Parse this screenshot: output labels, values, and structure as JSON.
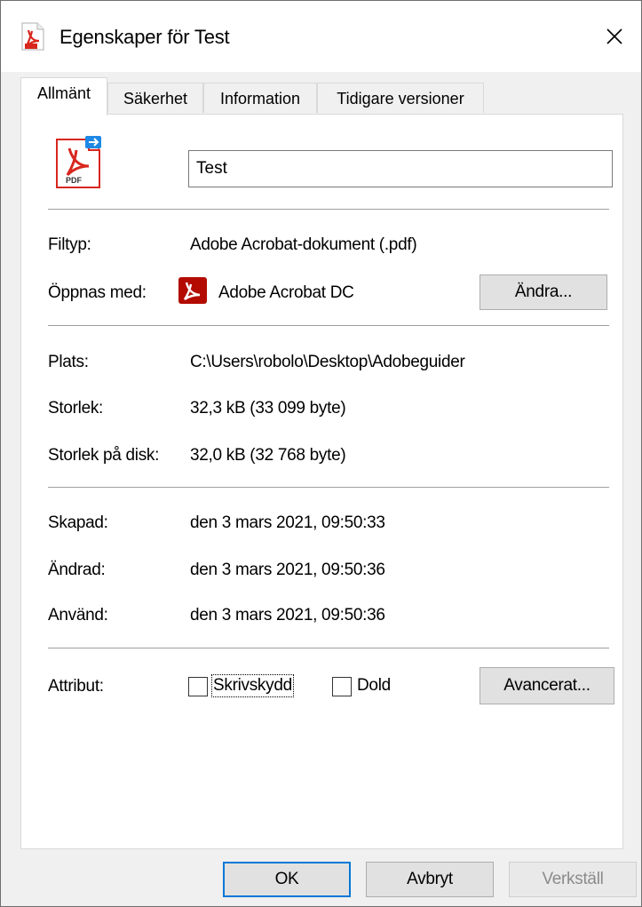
{
  "window": {
    "title": "Egenskaper för Test",
    "close_glyph": "✕"
  },
  "tabs": [
    {
      "label": "Allmänt",
      "active": true
    },
    {
      "label": "Säkerhet",
      "active": false
    },
    {
      "label": "Information",
      "active": false
    },
    {
      "label": "Tidigare versioner",
      "active": false
    }
  ],
  "general": {
    "file_icon_caption": "PDF",
    "name_value": "Test",
    "filetype": {
      "label": "Filtyp:",
      "value": "Adobe Acrobat-dokument (.pdf)"
    },
    "opens_with": {
      "label": "Öppnas med:",
      "value": "Adobe Acrobat DC",
      "change_button": "Ändra..."
    },
    "location": {
      "label": "Plats:",
      "value": "C:\\Users\\robolo\\Desktop\\Adobeguider"
    },
    "size": {
      "label": "Storlek:",
      "value": "32,3 kB (33 099 byte)"
    },
    "size_on_disk": {
      "label": "Storlek på disk:",
      "value": "32,0 kB (32 768 byte)"
    },
    "created": {
      "label": "Skapad:",
      "value": "den 3 mars 2021, 09:50:33"
    },
    "modified": {
      "label": "Ändrad:",
      "value": "den 3 mars 2021, 09:50:36"
    },
    "accessed": {
      "label": "Använd:",
      "value": "den 3 mars 2021, 09:50:36"
    },
    "attributes": {
      "label": "Attribut:",
      "readonly": {
        "label": "Skrivskydd",
        "checked": false
      },
      "hidden": {
        "label": "Dold",
        "checked": false
      },
      "advanced_button": "Avancerat..."
    }
  },
  "footer": {
    "ok": "OK",
    "cancel": "Avbryt",
    "apply": "Verkställ"
  },
  "colors": {
    "accent": "#0078d7",
    "pdf_red": "#d7271d",
    "acrobat_red": "#b30b00"
  }
}
